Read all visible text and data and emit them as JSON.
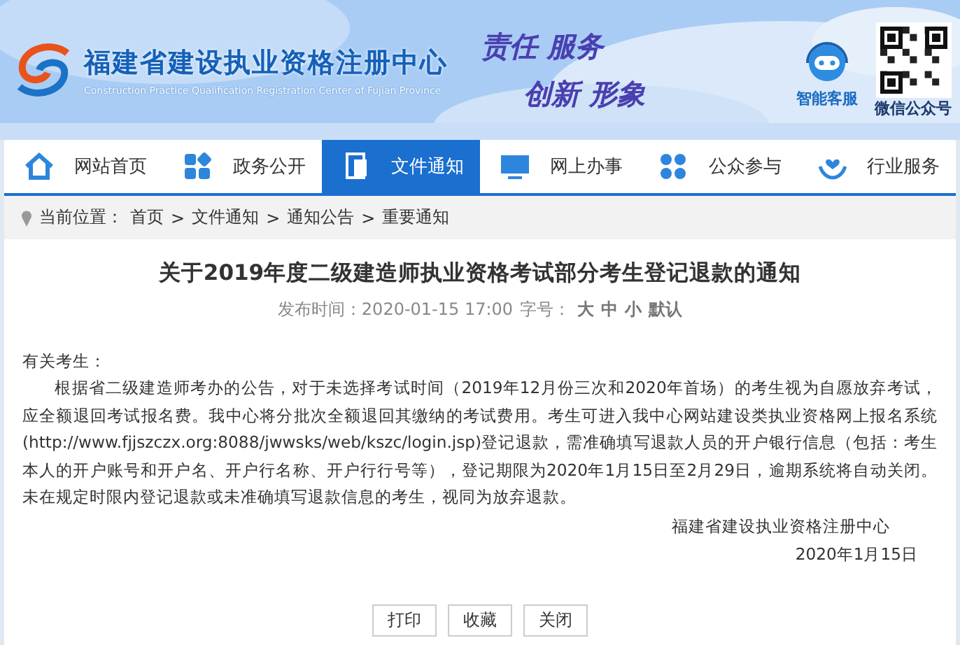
{
  "header": {
    "title": "福建省建设执业资格注册中心",
    "subtitle": "Construction Practice Qualification Registration Center of Fujian Province",
    "slogan": [
      "责任 服务",
      "创新 形象"
    ],
    "service_label": "智能客服",
    "wechat_label": "微信公众号"
  },
  "nav": [
    {
      "label": "网站首页",
      "selected": false
    },
    {
      "label": "政务公开",
      "selected": false
    },
    {
      "label": "文件通知",
      "selected": true
    },
    {
      "label": "网上办事",
      "selected": false
    },
    {
      "label": "公众参与",
      "selected": false
    },
    {
      "label": "行业服务",
      "selected": false
    }
  ],
  "breadcrumb": {
    "label": "当前位置：",
    "separator": ">",
    "items": [
      "首页",
      "文件通知",
      "通知公告",
      "重要通知"
    ]
  },
  "article": {
    "title": "关于2019年度二级建造师执业资格考试部分考生登记退款的通知",
    "published": "发布时间：2020-01-15 17:00",
    "font_label": "字号：",
    "font_sizes": [
      "大",
      "中",
      "小",
      "默认"
    ],
    "salutation": "有关考生：",
    "paragraph": "根据省二级建造师考办的公告，对于未选择考试时间（2019年12月份三次和2020年首场）的考生视为自愿放弃考试，应全额退回考试报名费。我中心将分批次全额退回其缴纳的考试费用。考生可进入我中心网站建设类执业资格网上报名系统(http://www.fjjszczx.org:8088/jwwsks/web/kszc/login.jsp)登记退款，需准确填写退款人员的开户银行信息（包括：考生本人的开户账号和开户名、开户行名称、开户行行号等），登记期限为2020年1月15日至2月29日，逾期系统将自动关闭。未在规定时限内登记退款或未准确填写退款信息的考生，视同为放弃退款。",
    "signature": "福建省建设执业资格注册中心",
    "date": "2020年1月15日"
  },
  "buttons": [
    "打印",
    "收藏",
    "关闭"
  ]
}
